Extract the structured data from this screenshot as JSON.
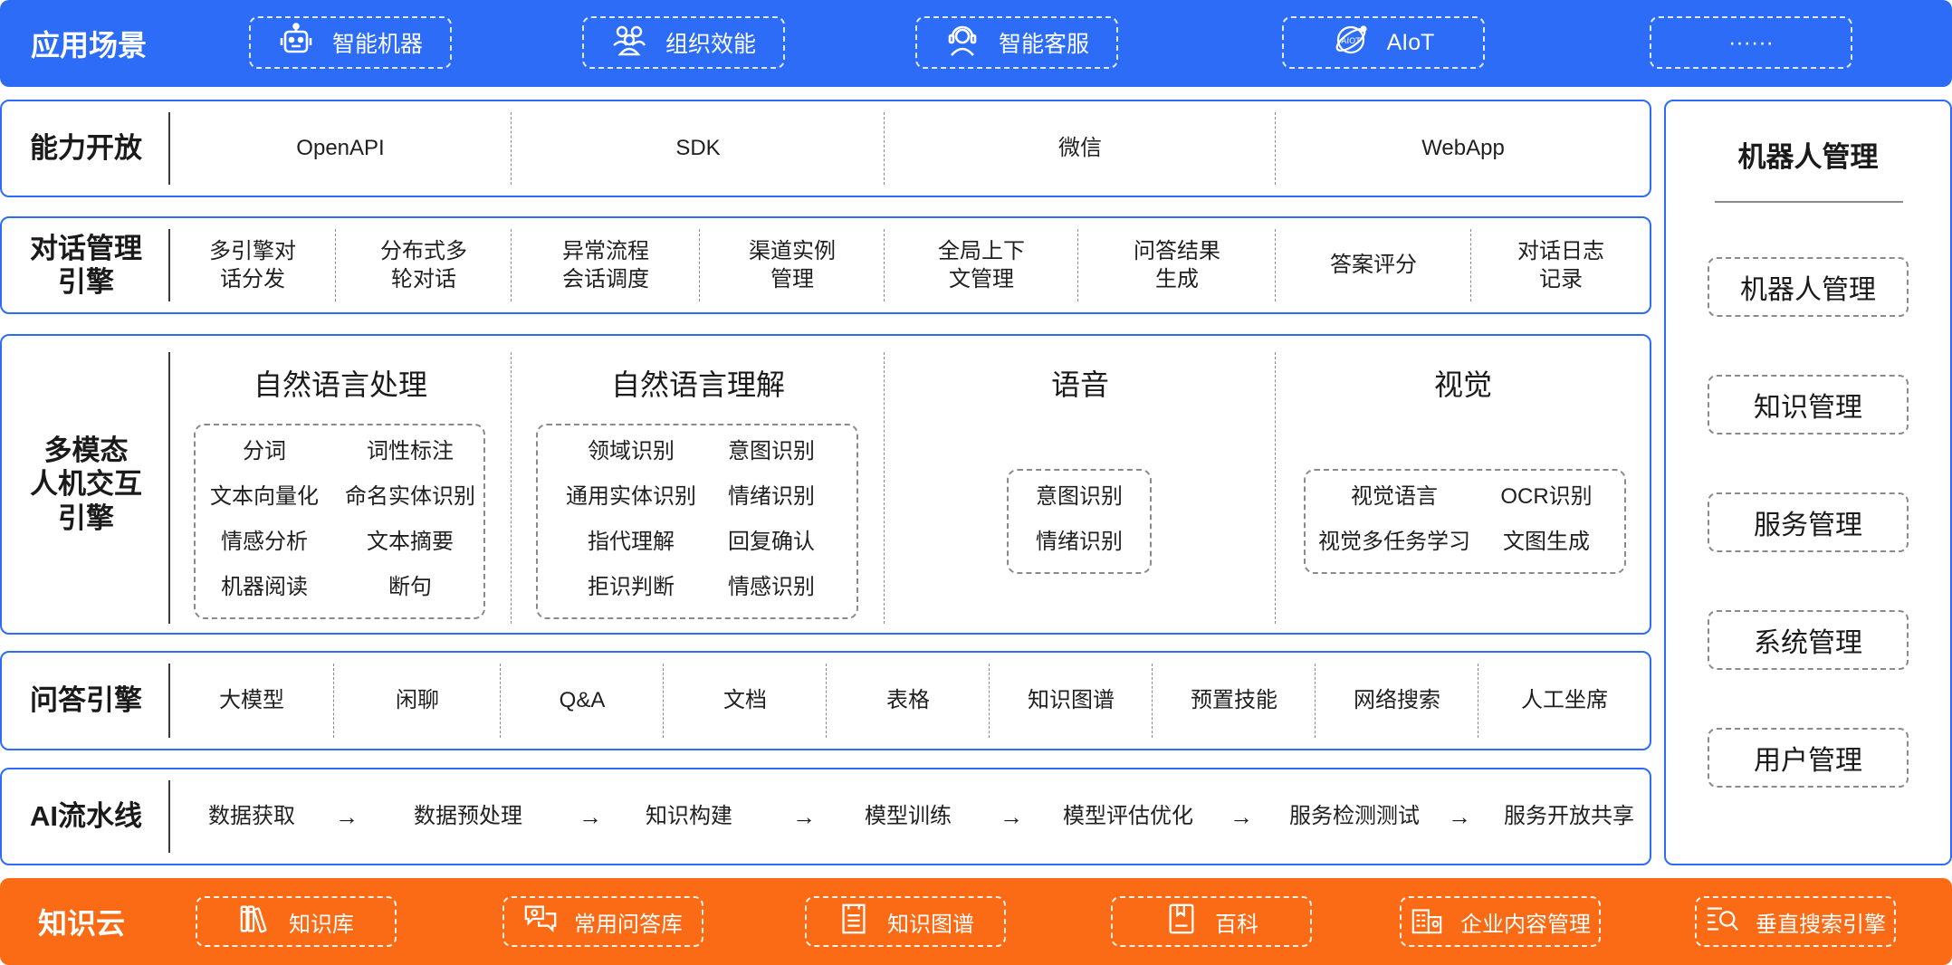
{
  "top": {
    "title": "应用场景",
    "items": [
      {
        "label": "智能机器",
        "icon": "robot-icon"
      },
      {
        "label": "组织效能",
        "icon": "team-icon"
      },
      {
        "label": "智能客服",
        "icon": "headset-agent-icon"
      },
      {
        "label": "AIoT",
        "icon": "aiot-globe-icon",
        "icon_text": "AIOT"
      },
      {
        "label": "······"
      }
    ]
  },
  "capability": {
    "title": "能力开放",
    "items": [
      "OpenAPI",
      "SDK",
      "微信",
      "WebApp"
    ]
  },
  "dialog": {
    "title": [
      "对话管理",
      "引擎"
    ],
    "items": [
      [
        "多引擎对",
        "话分发"
      ],
      [
        "分布式多",
        "轮对话"
      ],
      [
        "异常流程",
        "会话调度"
      ],
      [
        "渠道实例",
        "管理"
      ],
      [
        "全局上下",
        "文管理"
      ],
      [
        "问答结果",
        "生成"
      ],
      [
        "答案评分"
      ],
      [
        "对话日志",
        "记录"
      ]
    ]
  },
  "multimodal": {
    "title": [
      "多模态",
      "人机交互",
      "引擎"
    ],
    "nlp": {
      "title": "自然语言处理",
      "items": [
        "分词",
        "词性标注",
        "文本向量化",
        "命名实体识别",
        "情感分析",
        "文本摘要",
        "机器阅读",
        "断句"
      ]
    },
    "nlu": {
      "title": "自然语言理解",
      "items": [
        "领域识别",
        "意图识别",
        "通用实体识别",
        "情绪识别",
        "指代理解",
        "回复确认",
        "拒识判断",
        "情感识别"
      ]
    },
    "voice": {
      "title": "语音",
      "items": [
        "意图识别",
        "情绪识别"
      ]
    },
    "vision": {
      "title": "视觉",
      "items": [
        "视觉语言",
        "OCR识别",
        "视觉多任务学习",
        "文图生成"
      ]
    }
  },
  "qa": {
    "title": "问答引擎",
    "items": [
      "大模型",
      "闲聊",
      "Q&A",
      "文档",
      "表格",
      "知识图谱",
      "预置技能",
      "网络搜索",
      "人工坐席"
    ]
  },
  "pipeline": {
    "title": "AI流水线",
    "arrow": "→",
    "steps": [
      "数据获取",
      "数据预处理",
      "知识构建",
      "模型训练",
      "模型评估优化",
      "服务检测测试",
      "服务开放共享"
    ]
  },
  "robot_mgmt": {
    "title": "机器人管理",
    "items": [
      "机器人管理",
      "知识管理",
      "服务管理",
      "系统管理",
      "用户管理"
    ]
  },
  "knowledge_cloud": {
    "title": "知识云",
    "items": [
      {
        "label": "知识库",
        "icon": "books-icon"
      },
      {
        "label": "常用问答库",
        "icon": "qa-chat-icon"
      },
      {
        "label": "知识图谱",
        "icon": "document-list-icon"
      },
      {
        "label": "百科",
        "icon": "encyclopedia-icon"
      },
      {
        "label": "企业内容管理",
        "icon": "enterprise-building-icon"
      },
      {
        "label": "垂直搜索引擎",
        "icon": "search-list-icon"
      }
    ]
  },
  "colors": {
    "blue": "#2c6cf6",
    "orange": "#fb6a14",
    "text": "#1f1f1f",
    "dash": "#8a8a8a"
  }
}
